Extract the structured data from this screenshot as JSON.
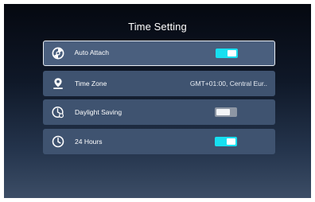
{
  "screen": {
    "title": "Time Setting"
  },
  "settings": [
    {
      "label": "Auto Attach",
      "icon": "auto-attach-icon",
      "toggle": "on",
      "selected": true
    },
    {
      "label": "Time Zone",
      "icon": "map-pin-icon",
      "value": "GMT+01:00, Central Eur.."
    },
    {
      "label": "Daylight Saving",
      "icon": "clock-sun-icon",
      "toggle": "off"
    },
    {
      "label": "24 Hours",
      "icon": "clock-icon",
      "toggle": "on"
    }
  ],
  "colors": {
    "toggle_on": "#17dff0",
    "toggle_off": "#8d96a4",
    "row_background": "#3f5370",
    "selected_border": "#e8edf3"
  }
}
